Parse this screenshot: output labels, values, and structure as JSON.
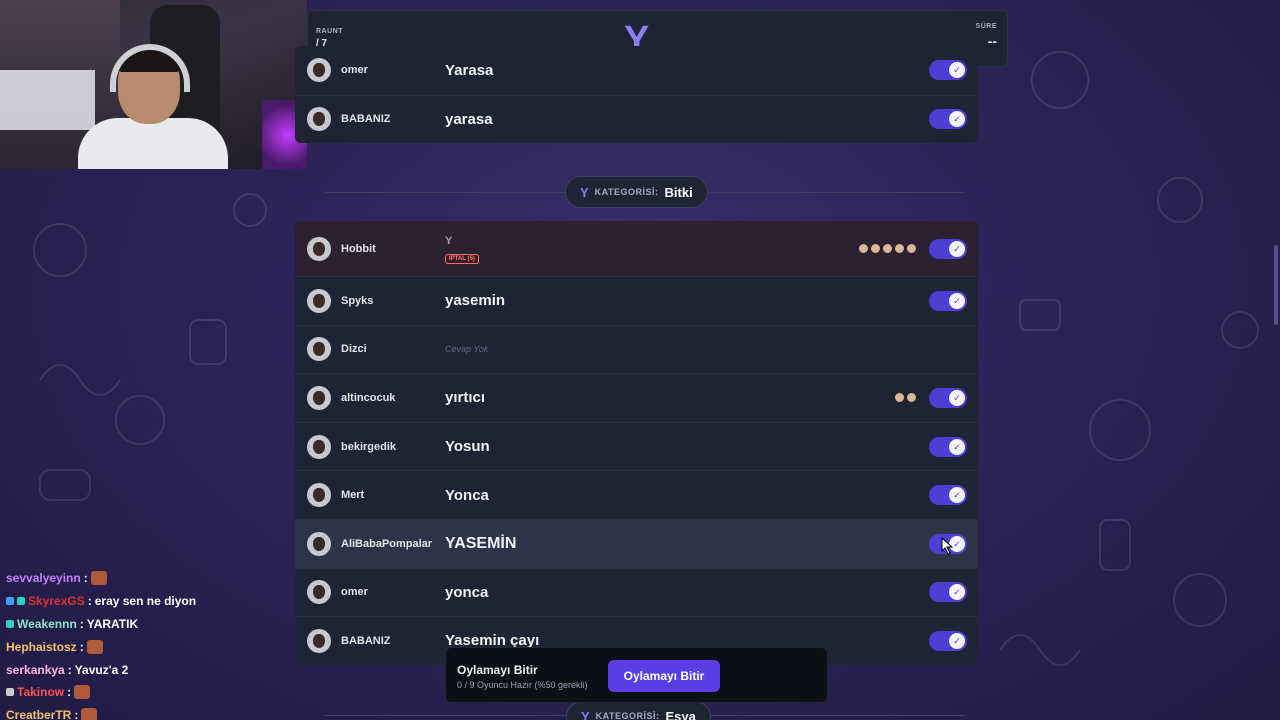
{
  "round_header": {
    "round_label": "RAUNT",
    "round_value": "/ 7",
    "letter": "Y",
    "time_label": "SÜRE",
    "time_value": "--"
  },
  "top_panel": {
    "rows": [
      {
        "player": "omer",
        "answer": "Yarasa"
      },
      {
        "player": "BABANIZ",
        "answer": "yarasa"
      }
    ]
  },
  "category_bitki": {
    "letter": "Y",
    "label": "KATEGORİSİ:",
    "name": "Bitki"
  },
  "category_esya": {
    "letter": "Y",
    "label": "KATEGORİSİ:",
    "name": "Eşya"
  },
  "bitki_panel": {
    "cancelled_row": {
      "player": "Hobbit",
      "answer": "Y",
      "badge": "İPTAL (5)",
      "voters": 5
    },
    "rows": [
      {
        "player": "Spyks",
        "answer": "yasemin"
      },
      {
        "player": "Dizci",
        "answer": "Cevap Yok"
      },
      {
        "player": "altincocuk",
        "answer": "yırtıcı",
        "voters": 2
      },
      {
        "player": "bekirgedik",
        "answer": "Yosun"
      },
      {
        "player": "Mert",
        "answer": "Yonca"
      },
      {
        "player": "AliBabaPompalar",
        "answer": "YASEMİN"
      },
      {
        "player": "omer",
        "answer": "yonca"
      },
      {
        "player": "BABANIZ",
        "answer": "Yasemin çayı"
      }
    ]
  },
  "vote_bar": {
    "title": "Oylamayı Bitir",
    "status": "0 / 9 Oyuncu Hazır (%50 gerekli)",
    "button_label": "Oylamayı Bitir"
  },
  "chat": [
    {
      "user": "sevvalyeyinn",
      "color": "#c77dff",
      "sep": " :",
      "message": "",
      "emote": true
    },
    {
      "user": "SkyrexGS",
      "color": "#e03030",
      "sep": " :",
      "message": "eray sen ne diyon",
      "emote": false
    },
    {
      "user": "Weakennn",
      "color": "#8fe3c8",
      "sep": " :",
      "message": "YARATIK",
      "emote": false
    },
    {
      "user": "Hephaistosz",
      "color": "#f3c16b",
      "sep": " :",
      "message": "",
      "emote": true
    },
    {
      "user": "serkankya",
      "color": "#ffb3e6",
      "sep": " :",
      "message": "Yavuz'a 2",
      "emote": false
    },
    {
      "user": "Takinow",
      "color": "#ff5050",
      "sep": " :",
      "message": "",
      "emote": true
    },
    {
      "user": "CreatberTR",
      "color": "#f3c16b",
      "sep": " :",
      "message": "",
      "emote": true
    }
  ],
  "colors": {
    "accent": "#5b3de6",
    "toggle": "#4b3fd6",
    "letter": "#8c7cf5",
    "cancel": "#ff6b6b"
  }
}
